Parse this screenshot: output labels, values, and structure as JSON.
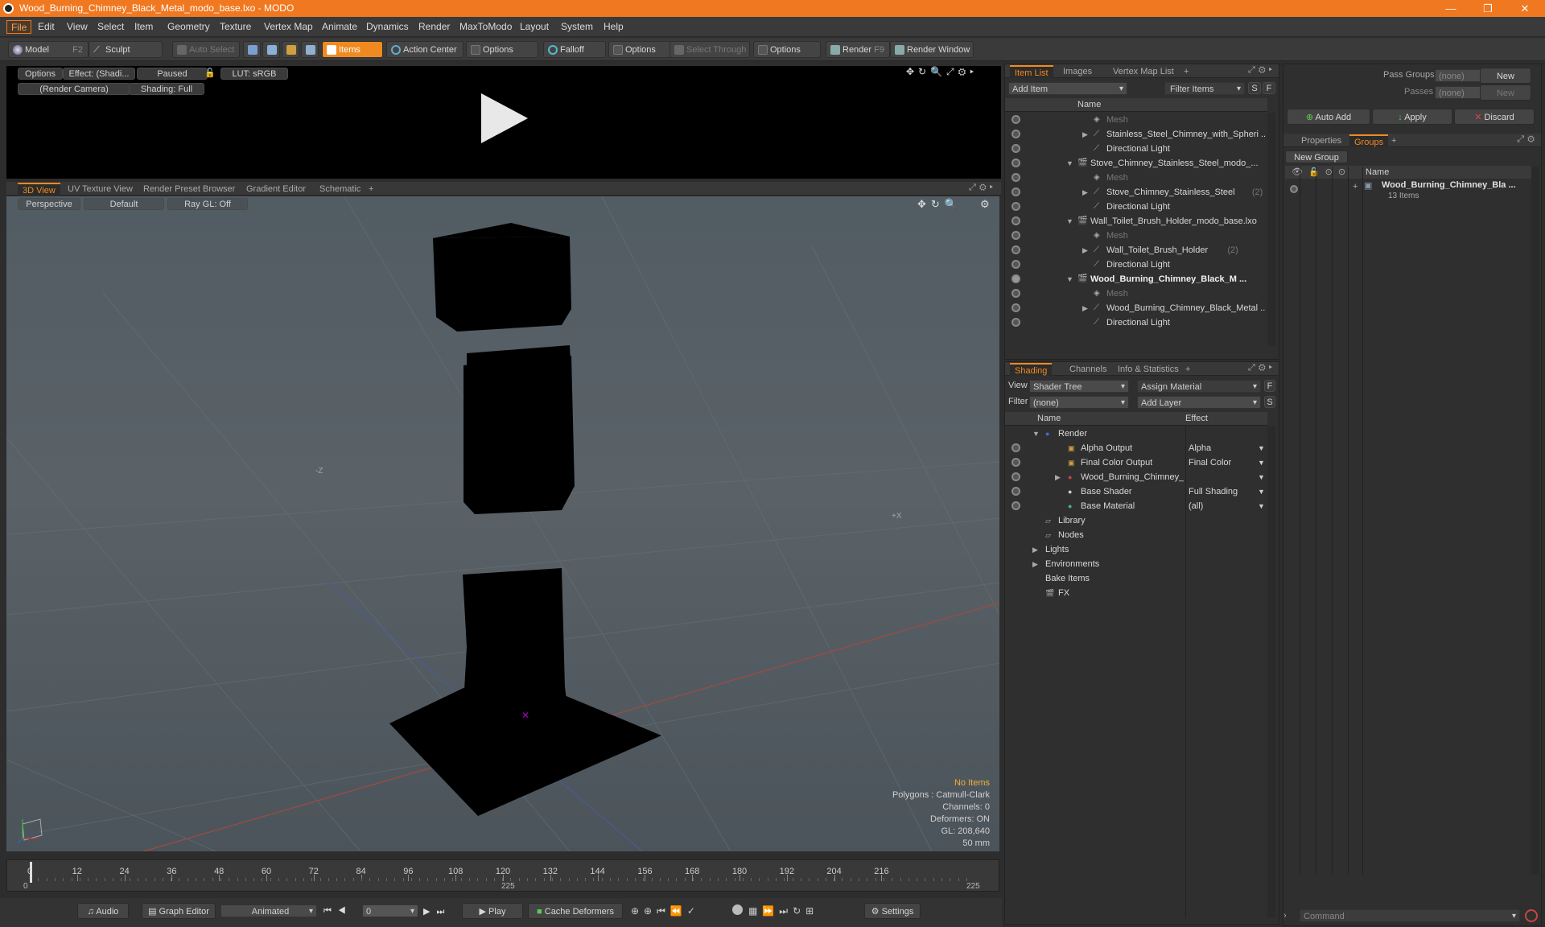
{
  "window": {
    "title": "Wood_Burning_Chimney_Black_Metal_modo_base.lxo - MODO",
    "minimize": "—",
    "maximize": "❐",
    "close": "✕"
  },
  "menu": [
    "File",
    "Edit",
    "View",
    "Select",
    "Item",
    "Geometry",
    "Texture",
    "Vertex Map",
    "Animate",
    "Dynamics",
    "Render",
    "MaxToModo",
    "Layout",
    "System",
    "Help"
  ],
  "toolbar": {
    "model": "Model",
    "model_key": "F2",
    "sculpt": "Sculpt",
    "auto_select": "Auto Select",
    "items": "Items",
    "action_center": "Action Center",
    "options1": "Options",
    "falloff": "Falloff",
    "options2": "Options",
    "select_through": "Select Through",
    "options3": "Options",
    "render": "Render",
    "render_key": "F9",
    "render_window": "Render Window"
  },
  "preview": {
    "options": "Options",
    "effect": "Effect: (Shadi...",
    "paused": "Paused",
    "lut": "LUT: sRGB",
    "camera": "(Render Camera)",
    "shading": "Shading: Full"
  },
  "viewport_tabs": [
    "3D View",
    "UV Texture View",
    "Render Preset Browser",
    "Gradient Editor",
    "Schematic",
    "+"
  ],
  "viewport": {
    "perspective": "Perspective",
    "default": "Default",
    "raygl": "Ray GL: Off",
    "axis_z": "-Z",
    "axis_x": "+X",
    "stats": {
      "no_items": "No Items",
      "polygons": "Polygons : Catmull-Clark",
      "channels": "Channels: 0",
      "deformers": "Deformers: ON",
      "gl": "GL: 208,640",
      "mm": "50 mm"
    }
  },
  "timeline": {
    "ticks": [
      "0",
      "12",
      "24",
      "36",
      "48",
      "60",
      "72",
      "84",
      "96",
      "108",
      "120",
      "132",
      "144",
      "156",
      "168",
      "180",
      "192",
      "204",
      "216"
    ],
    "start": "0",
    "mid": "225",
    "end": "225"
  },
  "bottom": {
    "audio": "Audio",
    "graph_editor": "Graph Editor",
    "animated": "Animated",
    "frame": "0",
    "play": "Play",
    "cache": "Cache Deformers",
    "settings": "Settings"
  },
  "item_list": {
    "tabs": [
      "Item List",
      "Images",
      "Vertex Map List",
      "+"
    ],
    "add_item": "Add Item",
    "filter_items": "Filter Items",
    "f": "F",
    "s": "S",
    "col_name": "Name",
    "rows": [
      {
        "label": "Mesh",
        "style": "gray",
        "indent": 1
      },
      {
        "label": "Stainless_Steel_Chimney_with_Spheri ...",
        "style": "",
        "indent": 1,
        "arrow": "▶"
      },
      {
        "label": "Directional Light",
        "style": "",
        "indent": 1
      },
      {
        "label": "Stove_Chimney_Stainless_Steel_modo_...",
        "style": "",
        "indent": 0,
        "arrow": "▼"
      },
      {
        "label": "Mesh",
        "style": "gray",
        "indent": 1
      },
      {
        "label": "Stove_Chimney_Stainless_Steel",
        "suffix": "(2)",
        "style": "",
        "indent": 1,
        "arrow": "▶"
      },
      {
        "label": "Directional Light",
        "style": "",
        "indent": 1
      },
      {
        "label": "Wall_Toilet_Brush_Holder_modo_base.lxo",
        "style": "",
        "indent": 0,
        "arrow": "▼"
      },
      {
        "label": "Mesh",
        "style": "gray",
        "indent": 1
      },
      {
        "label": "Wall_Toilet_Brush_Holder",
        "suffix": "(2)",
        "style": "",
        "indent": 1,
        "arrow": "▶"
      },
      {
        "label": "Directional Light",
        "style": "",
        "indent": 1
      },
      {
        "label": "Wood_Burning_Chimney_Black_M ...",
        "style": "bold",
        "indent": 0,
        "arrow": "▼"
      },
      {
        "label": "Mesh",
        "style": "gray",
        "indent": 1
      },
      {
        "label": "Wood_Burning_Chimney_Black_Metal ...",
        "style": "",
        "indent": 1,
        "arrow": "▶"
      },
      {
        "label": "Directional Light",
        "style": "",
        "indent": 1
      }
    ]
  },
  "shading": {
    "tabs": [
      "Shading",
      "Channels",
      "Info & Statistics",
      "+"
    ],
    "view_label": "View",
    "view_value": "Shader Tree",
    "assign_material": "Assign Material",
    "filter_label": "Filter",
    "filter_value": "(none)",
    "add_layer": "Add Layer",
    "col_name": "Name",
    "col_effect": "Effect",
    "rows": [
      {
        "label": "Render",
        "effect": "",
        "indent": 0,
        "arrow": "▼",
        "eye": false
      },
      {
        "label": "Alpha Output",
        "effect": "Alpha",
        "indent": 1,
        "eye": true
      },
      {
        "label": "Final Color Output",
        "effect": "Final Color",
        "indent": 1,
        "eye": true
      },
      {
        "label": "Wood_Burning_Chimney_B...",
        "effect": "",
        "indent": 1,
        "arrow": "▶",
        "eye": true
      },
      {
        "label": "Base Shader",
        "effect": "Full Shading",
        "indent": 1,
        "eye": true
      },
      {
        "label": "Base Material",
        "effect": "(all)",
        "indent": 1,
        "eye": true
      },
      {
        "label": "Library",
        "effect": "",
        "indent": 0,
        "eye": false
      },
      {
        "label": "Nodes",
        "effect": "",
        "indent": 0,
        "eye": false
      },
      {
        "label": "Lights",
        "effect": "",
        "indent": -1,
        "arrow": "▶",
        "eye": false
      },
      {
        "label": "Environments",
        "effect": "",
        "indent": -1,
        "arrow": "▶",
        "eye": false
      },
      {
        "label": "Bake Items",
        "effect": "",
        "indent": -1,
        "eye": false
      },
      {
        "label": "FX",
        "effect": "",
        "indent": 0,
        "eye": false
      }
    ]
  },
  "right": {
    "pass_groups": "Pass Groups",
    "passes": "Passes",
    "none": "(none)",
    "new": "New",
    "auto_add": "Auto Add",
    "apply": "Apply",
    "discard": "Discard",
    "tabs": [
      "Properties",
      "Groups",
      "+"
    ],
    "new_group": "New Group",
    "col_name": "Name",
    "group_name": "Wood_Burning_Chimney_Bla ...",
    "group_count": "13 Items",
    "command_placeholder": "Command"
  }
}
